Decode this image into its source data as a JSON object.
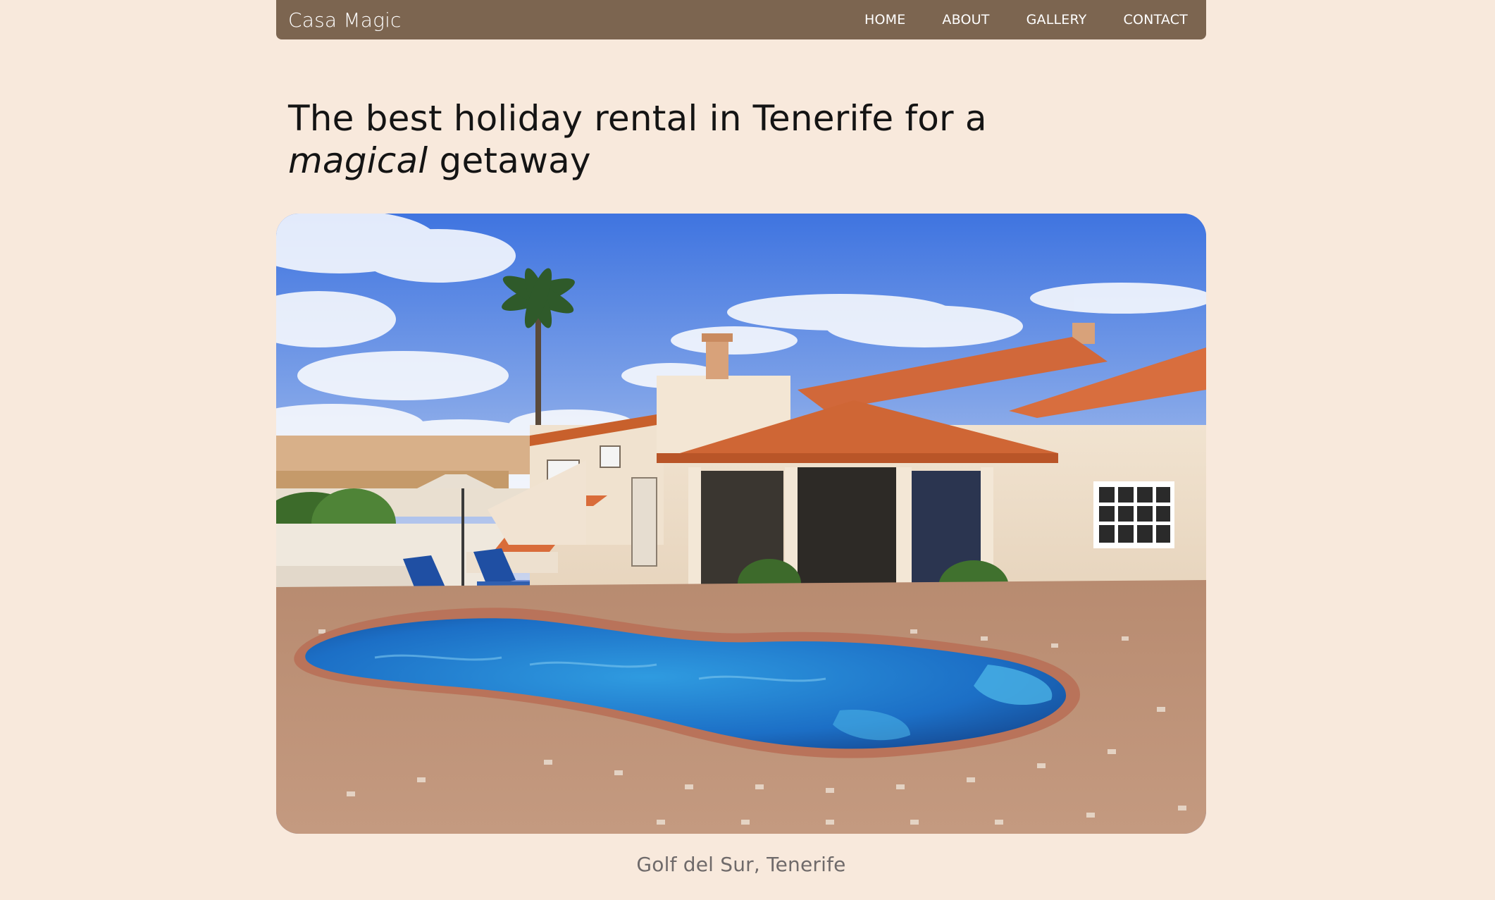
{
  "nav": {
    "brand": "Casa Magic",
    "links": [
      "HOME",
      "ABOUT",
      "GALLERY",
      "CONTACT"
    ]
  },
  "hero": {
    "headline_before": "The best holiday rental in Tenerife for a",
    "headline_emphasis": "magical",
    "headline_after": "getaway",
    "image_subject": "villa-with-pool-photo",
    "caption": "Golf del Sur, Tenerife"
  },
  "colors": {
    "background": "#f8e9dc",
    "navbar": "#7c6550",
    "text": "#141414",
    "caption": "#6f6a6a"
  }
}
